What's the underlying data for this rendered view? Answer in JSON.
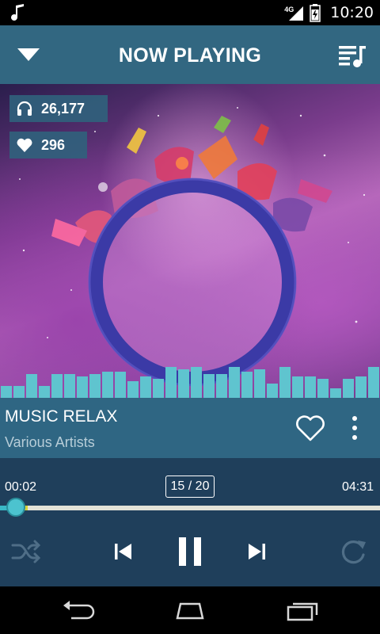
{
  "status_bar": {
    "time": "10:20",
    "network": "4G",
    "icons": [
      "music-note-icon",
      "signal-icon",
      "battery-icon"
    ]
  },
  "app_bar": {
    "title": "NOW PLAYING",
    "left_icon": "chevron-down-icon",
    "right_icon": "playlist-icon"
  },
  "album": {
    "listens": "26,177",
    "likes": "296",
    "listens_icon": "headphones-icon",
    "likes_icon": "heart-icon",
    "visualizer_levels": [
      0.25,
      0.25,
      0.5,
      0.25,
      0.5,
      0.5,
      0.45,
      0.5,
      0.55,
      0.55,
      0.35,
      0.45,
      0.4,
      0.65,
      0.6,
      0.65,
      0.5,
      0.5,
      0.65,
      0.55,
      0.6,
      0.3,
      0.65,
      0.45,
      0.45,
      0.4,
      0.2,
      0.4,
      0.45,
      0.65
    ]
  },
  "track": {
    "title": "MUSIC RELAX",
    "artist": "Various Artists"
  },
  "player": {
    "elapsed": "00:02",
    "duration": "04:31",
    "index": "15 / 20",
    "progress": 0.008,
    "buffer": 0.06
  },
  "colors": {
    "app_bar": "#326781",
    "track_info": "#2f6683",
    "player": "#1f3f5b",
    "accent": "#3ab9c6",
    "visualizer": "#5fc4cf"
  },
  "nav": {
    "icons": [
      "back-icon",
      "home-icon",
      "recent-apps-icon"
    ]
  }
}
